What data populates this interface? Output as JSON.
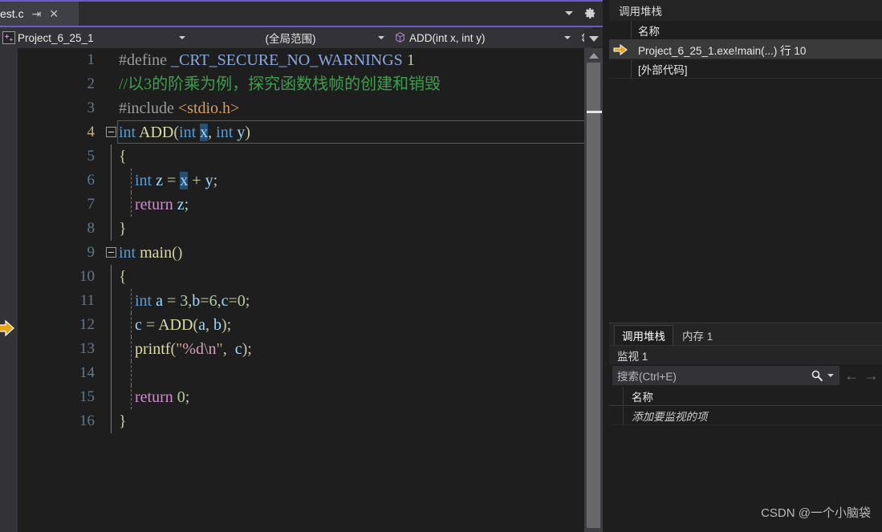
{
  "editor": {
    "tab": {
      "label": "est.c",
      "pin_icon": "pin-icon",
      "close_icon": "close-icon"
    },
    "tab_overflow_icon": "chevron-down-icon",
    "settings_icon": "gear-icon",
    "navbar": {
      "project": "Project_6_25_1",
      "scope": "(全局范围)",
      "member": "ADD(int x, int y)",
      "project_icon": "cpp-project-icon",
      "member_icon": "cube-icon",
      "split_icon": "split-view-icon"
    },
    "statement_arrow_icon": "current-statement-arrow-icon",
    "lines": [
      {
        "n": "1",
        "fold": null,
        "indent": null,
        "tokens": [
          {
            "t": "#define ",
            "c": "t-pre"
          },
          {
            "t": "_CRT_SECURE_NO_WARNINGS ",
            "c": "t-macro"
          },
          {
            "t": "1",
            "c": "t-num"
          }
        ]
      },
      {
        "n": "2",
        "fold": null,
        "indent": null,
        "tokens": [
          {
            "t": "//以3的阶乘为例，探究函数栈帧的创建和销毁",
            "c": "t-cmt"
          }
        ]
      },
      {
        "n": "3",
        "fold": null,
        "indent": null,
        "tokens": [
          {
            "t": "#include ",
            "c": "t-pre"
          },
          {
            "t": "<stdio.h>",
            "c": "t-inc"
          }
        ]
      },
      {
        "n": "4",
        "fold": "minus",
        "indent": null,
        "current": true,
        "tokens": [
          {
            "t": "int",
            "c": "t-kw"
          },
          {
            "t": " ",
            "c": "t-plain"
          },
          {
            "t": "ADD",
            "c": "t-fn"
          },
          {
            "t": "(",
            "c": "t-punc"
          },
          {
            "t": "int",
            "c": "t-kw"
          },
          {
            "t": " ",
            "c": "t-plain"
          },
          {
            "t": "x",
            "c": "sel"
          },
          {
            "t": ",",
            "c": "t-punc"
          },
          {
            "t": " ",
            "c": "t-plain"
          },
          {
            "t": "int",
            "c": "t-kw"
          },
          {
            "t": " ",
            "c": "t-plain"
          },
          {
            "t": "y",
            "c": "t-var"
          },
          {
            "t": ")",
            "c": "t-punc"
          }
        ]
      },
      {
        "n": "5",
        "fold": null,
        "indent": "line",
        "tokens": [
          {
            "t": "{",
            "c": "t-punc"
          }
        ]
      },
      {
        "n": "6",
        "fold": null,
        "indent": "dash",
        "tokens": [
          {
            "t": "    ",
            "c": "t-plain"
          },
          {
            "t": "int",
            "c": "t-kw"
          },
          {
            "t": " ",
            "c": "t-plain"
          },
          {
            "t": "z",
            "c": "t-var"
          },
          {
            "t": " ",
            "c": "t-plain"
          },
          {
            "t": "=",
            "c": "t-punc"
          },
          {
            "t": " ",
            "c": "t-plain"
          },
          {
            "t": "x",
            "c": "sel"
          },
          {
            "t": " ",
            "c": "t-plain"
          },
          {
            "t": "+",
            "c": "t-punc"
          },
          {
            "t": " ",
            "c": "t-plain"
          },
          {
            "t": "y",
            "c": "t-var"
          },
          {
            "t": ";",
            "c": "t-punc"
          }
        ]
      },
      {
        "n": "7",
        "fold": null,
        "indent": "dash",
        "tokens": [
          {
            "t": "    ",
            "c": "t-plain"
          },
          {
            "t": "return",
            "c": "t-ret"
          },
          {
            "t": " ",
            "c": "t-plain"
          },
          {
            "t": "z",
            "c": "t-var"
          },
          {
            "t": ";",
            "c": "t-punc"
          }
        ]
      },
      {
        "n": "8",
        "fold": null,
        "indent": "line",
        "tokens": [
          {
            "t": "}",
            "c": "t-punc"
          }
        ]
      },
      {
        "n": "9",
        "fold": "minus",
        "indent": null,
        "tokens": [
          {
            "t": "int",
            "c": "t-kw"
          },
          {
            "t": " ",
            "c": "t-plain"
          },
          {
            "t": "main",
            "c": "t-fn"
          },
          {
            "t": "()",
            "c": "t-punc"
          }
        ]
      },
      {
        "n": "10",
        "fold": null,
        "indent": "line",
        "tokens": [
          {
            "t": "{",
            "c": "t-punc"
          }
        ]
      },
      {
        "n": "11",
        "fold": null,
        "indent": "dash",
        "tokens": [
          {
            "t": "    ",
            "c": "t-plain"
          },
          {
            "t": "int",
            "c": "t-kw"
          },
          {
            "t": " ",
            "c": "t-plain"
          },
          {
            "t": "a",
            "c": "t-var"
          },
          {
            "t": " ",
            "c": "t-plain"
          },
          {
            "t": "=",
            "c": "t-punc"
          },
          {
            "t": " ",
            "c": "t-plain"
          },
          {
            "t": "3",
            "c": "t-num"
          },
          {
            "t": ",",
            "c": "t-punc"
          },
          {
            "t": "b",
            "c": "t-var"
          },
          {
            "t": "=",
            "c": "t-punc"
          },
          {
            "t": "6",
            "c": "t-num"
          },
          {
            "t": ",",
            "c": "t-punc"
          },
          {
            "t": "c",
            "c": "t-var"
          },
          {
            "t": "=",
            "c": "t-punc"
          },
          {
            "t": "0",
            "c": "t-num"
          },
          {
            "t": ";",
            "c": "t-punc"
          }
        ]
      },
      {
        "n": "12",
        "fold": null,
        "indent": "dash",
        "tokens": [
          {
            "t": "    ",
            "c": "t-plain"
          },
          {
            "t": "c",
            "c": "t-var"
          },
          {
            "t": " ",
            "c": "t-plain"
          },
          {
            "t": "=",
            "c": "t-punc"
          },
          {
            "t": " ",
            "c": "t-plain"
          },
          {
            "t": "ADD",
            "c": "t-fn"
          },
          {
            "t": "(",
            "c": "t-punc"
          },
          {
            "t": "a",
            "c": "t-var"
          },
          {
            "t": ",",
            "c": "t-punc"
          },
          {
            "t": " ",
            "c": "t-plain"
          },
          {
            "t": "b",
            "c": "t-var"
          },
          {
            "t": ");",
            "c": "t-punc"
          }
        ]
      },
      {
        "n": "13",
        "fold": null,
        "indent": "dash",
        "tokens": [
          {
            "t": "    ",
            "c": "t-plain"
          },
          {
            "t": "printf",
            "c": "t-fn"
          },
          {
            "t": "(",
            "c": "t-punc"
          },
          {
            "t": "\"",
            "c": "t-str"
          },
          {
            "t": "%d",
            "c": "t-esc"
          },
          {
            "t": "\\n",
            "c": "t-esc"
          },
          {
            "t": "\"",
            "c": "t-str"
          },
          {
            "t": ",",
            "c": "t-punc"
          },
          {
            "t": "  ",
            "c": "t-plain"
          },
          {
            "t": "c",
            "c": "t-var"
          },
          {
            "t": ");",
            "c": "t-punc"
          }
        ]
      },
      {
        "n": "14",
        "fold": null,
        "indent": "dash",
        "tokens": []
      },
      {
        "n": "15",
        "fold": null,
        "indent": "dash",
        "tokens": [
          {
            "t": "    ",
            "c": "t-plain"
          },
          {
            "t": "return",
            "c": "t-ret"
          },
          {
            "t": " ",
            "c": "t-plain"
          },
          {
            "t": "0",
            "c": "t-num"
          },
          {
            "t": ";",
            "c": "t-punc"
          }
        ]
      },
      {
        "n": "16",
        "fold": null,
        "indent": "line",
        "tokens": [
          {
            "t": "}",
            "c": "t-punc"
          }
        ]
      }
    ],
    "scrollbar": {
      "up_icon": "scroll-up-arrow-icon",
      "overflow_icon": "chevron-down-icon"
    }
  },
  "callstack": {
    "title": "调用堆栈",
    "column_name": "名称",
    "rows": [
      {
        "name": "Project_6_25_1.exe!main(...) 行 10",
        "active": true,
        "marker_icon": "current-frame-arrow-icon"
      },
      {
        "name": "[外部代码]",
        "active": false,
        "marker_icon": null
      }
    ]
  },
  "panel_tabs": [
    {
      "label": "调用堆栈",
      "selected": true
    },
    {
      "label": "内存 1",
      "selected": false
    }
  ],
  "watch": {
    "title": "监视 1",
    "search_placeholder": "搜索(Ctrl+E)",
    "search_value": "",
    "search_icon": "magnifier-icon",
    "search_dropdown_icon": "chevron-down-icon",
    "prev_icon": "arrow-left-icon",
    "next_icon": "arrow-right-icon",
    "column_name": "名称",
    "rows": [
      {
        "name": "添加要监视的项"
      }
    ]
  },
  "watermark": "CSDN @一个小脑袋",
  "colors": {
    "accent": "#6a5acd",
    "editor_bg": "#1e1e1e",
    "panel_bg": "#252526",
    "selection": "#264f78",
    "arrow_yellow": "#e8a317"
  }
}
